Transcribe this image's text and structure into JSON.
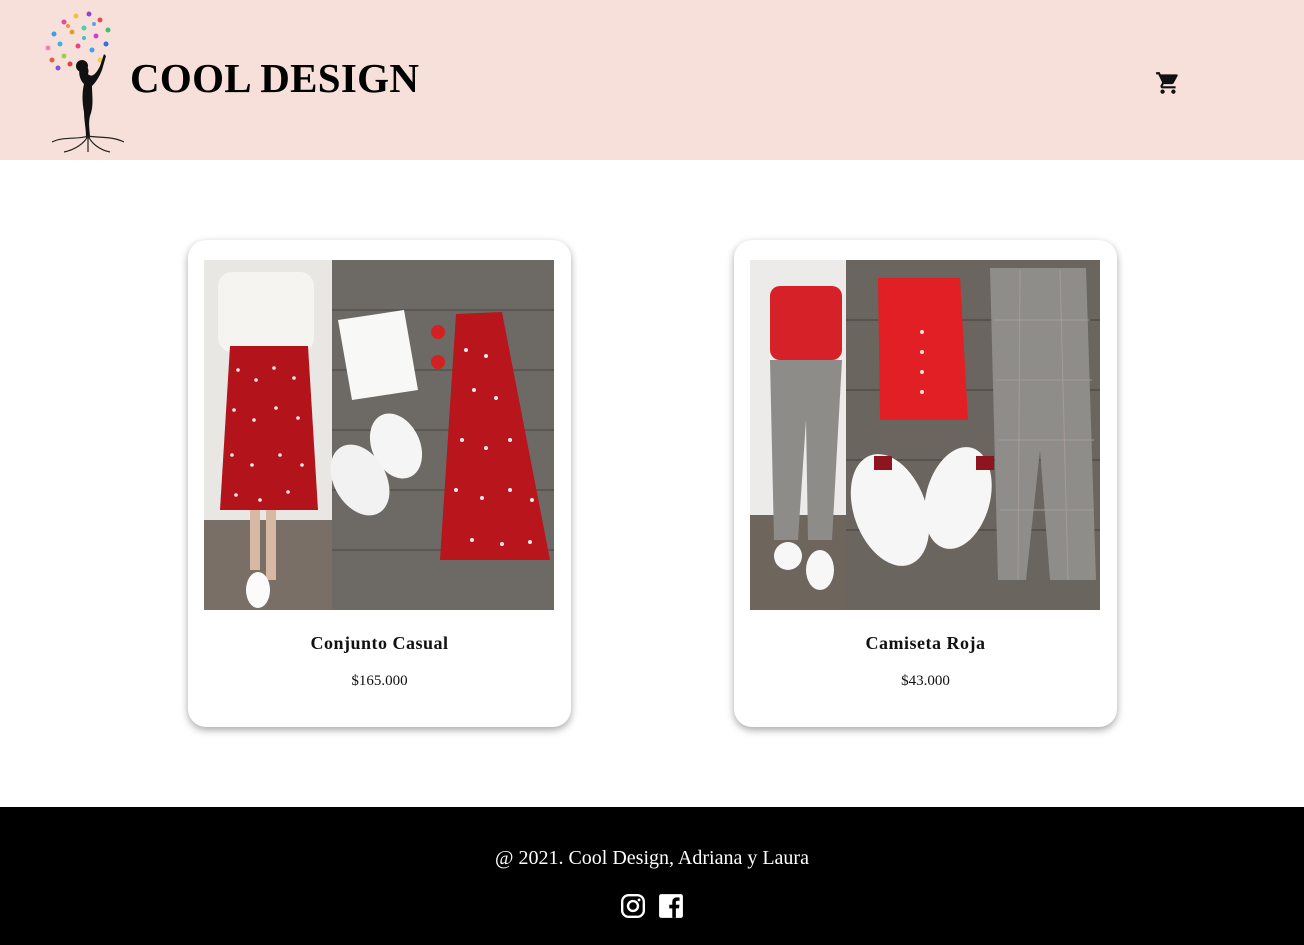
{
  "header": {
    "brand": "COOL DESIGN",
    "cart_icon": "shopping-cart-icon",
    "background": "#f7e0da"
  },
  "products": [
    {
      "name": "Conjunto Casual",
      "price": "$165.000",
      "image": "outfit-white-blouse-red-polka-dot-skirt"
    },
    {
      "name": "Camiseta Roja",
      "price": "$43.000",
      "image": "outfit-red-polo-plaid-pants"
    }
  ],
  "footer": {
    "copyright": "@ 2021. Cool Design, Adriana y Laura",
    "social": [
      "instagram-icon",
      "facebook-icon"
    ],
    "background": "#000000"
  }
}
